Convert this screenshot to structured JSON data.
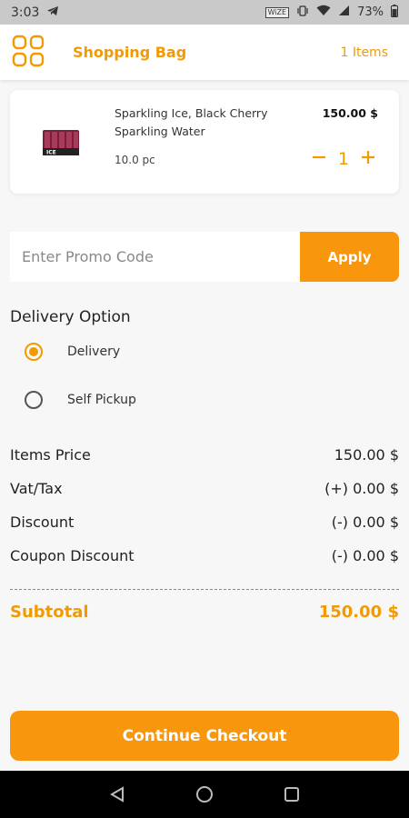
{
  "status_bar": {
    "time": "3:03",
    "carrier_badge": "WiZE",
    "battery": "73%"
  },
  "header": {
    "title": "Shopping Bag",
    "item_count": "1 Items"
  },
  "cart": {
    "items": [
      {
        "name": "Sparkling Ice, Black Cherry Sparkling Water",
        "unit": "10.0 pc",
        "price": "150.00 $",
        "quantity": "1",
        "image_text": "ICE"
      }
    ]
  },
  "promo": {
    "placeholder": "Enter Promo Code",
    "value": "",
    "apply_label": "Apply"
  },
  "delivery": {
    "heading": "Delivery Option",
    "options": [
      {
        "label": "Delivery",
        "selected": true
      },
      {
        "label": "Self Pickup",
        "selected": false
      }
    ]
  },
  "summary": {
    "rows": [
      {
        "label": "Items Price",
        "value": "150.00 $"
      },
      {
        "label": "Vat/Tax",
        "value": "(+) 0.00 $"
      },
      {
        "label": "Discount",
        "value": "(-) 0.00 $"
      },
      {
        "label": "Coupon Discount",
        "value": "(-) 0.00 $"
      }
    ],
    "subtotal_label": "Subtotal",
    "subtotal_value": "150.00 $"
  },
  "checkout": {
    "label": "Continue Checkout"
  },
  "colors": {
    "accent": "#f29a00",
    "button": "#f8960d",
    "background": "#f7f7f7"
  },
  "icons": {
    "menu": "grid-menu-icon",
    "back": "back-triangle-icon",
    "home": "home-circle-icon",
    "recents": "recents-square-icon"
  }
}
